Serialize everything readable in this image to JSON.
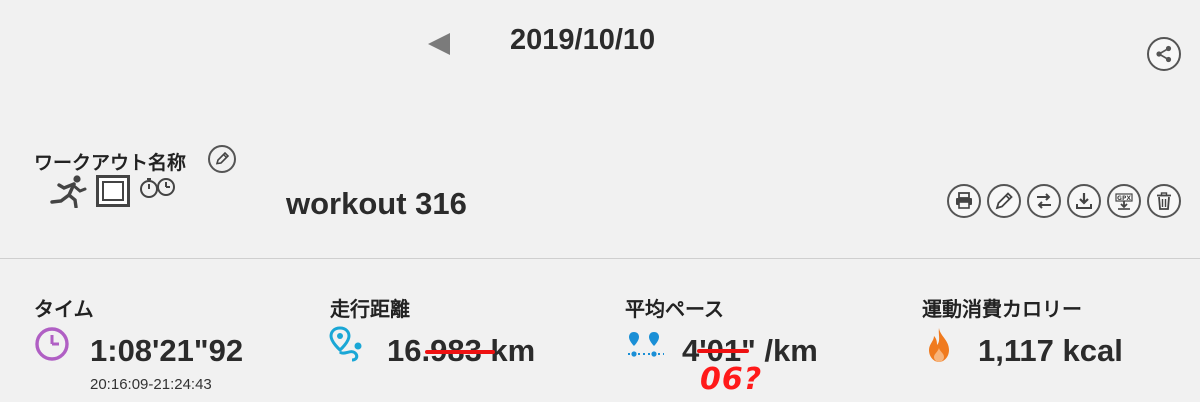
{
  "header": {
    "date": "2019/10/10",
    "icons": {
      "prev": "triangle-left-icon",
      "share": "share-icon"
    }
  },
  "workout": {
    "name_label": "ワークアウト名称",
    "title": "workout 316",
    "type_icons": [
      "runner-icon",
      "treadmill-screen-icon",
      "stopwatch-icon"
    ]
  },
  "toolbar": {
    "icons": [
      "print-icon",
      "edit-icon",
      "swap-icon",
      "download-icon",
      "gpx-export-icon",
      "trash-icon"
    ],
    "gpx_label": "GPX"
  },
  "stats": {
    "time": {
      "label": "タイム",
      "value": "1:08'21\"92",
      "range": "20:16:09-21:24:43",
      "icon": "clock-icon",
      "color": "#b05fc4"
    },
    "distance": {
      "label": "走行距離",
      "value": "16.983 km",
      "icon": "route-pin-icon",
      "color": "#1aa7d6"
    },
    "pace": {
      "label": "平均ペース",
      "value": "4'01\" /km",
      "icon": "pace-pins-icon",
      "color": "#1a8fd6"
    },
    "calories": {
      "label": "運動消費カロリー",
      "value": "1,117 kcal",
      "icon": "flame-icon",
      "color": "#f07a1e"
    }
  },
  "annotation": {
    "handwritten": "06?",
    "color": "#ff1a1a"
  }
}
